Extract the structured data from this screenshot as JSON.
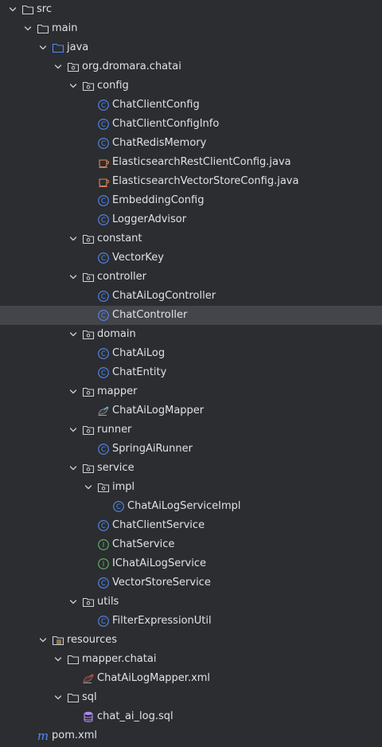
{
  "tree": {
    "items": [
      {
        "label": "src",
        "depth": 0,
        "icon": "folder-icon",
        "expanded": true
      },
      {
        "label": "main",
        "depth": 1,
        "icon": "folder-icon",
        "expanded": true
      },
      {
        "label": "java",
        "depth": 2,
        "icon": "source-root-folder-icon",
        "expanded": true
      },
      {
        "label": "org.dromara.chatai",
        "depth": 3,
        "icon": "package-icon",
        "expanded": true
      },
      {
        "label": "config",
        "depth": 4,
        "icon": "package-icon",
        "expanded": true
      },
      {
        "label": "ChatClientConfig",
        "depth": 5,
        "icon": "class-icon"
      },
      {
        "label": "ChatClientConfigInfo",
        "depth": 5,
        "icon": "class-icon"
      },
      {
        "label": "ChatRedisMemory",
        "depth": 5,
        "icon": "class-icon"
      },
      {
        "label": "ElasticsearchRestClientConfig.java",
        "depth": 5,
        "icon": "java-file-icon"
      },
      {
        "label": "ElasticsearchVectorStoreConfig.java",
        "depth": 5,
        "icon": "java-file-icon"
      },
      {
        "label": "EmbeddingConfig",
        "depth": 5,
        "icon": "class-icon"
      },
      {
        "label": "LoggerAdvisor",
        "depth": 5,
        "icon": "class-icon"
      },
      {
        "label": "constant",
        "depth": 4,
        "icon": "package-icon",
        "expanded": true
      },
      {
        "label": "VectorKey",
        "depth": 5,
        "icon": "class-icon"
      },
      {
        "label": "controller",
        "depth": 4,
        "icon": "package-icon",
        "expanded": true
      },
      {
        "label": "ChatAiLogController",
        "depth": 5,
        "icon": "class-icon"
      },
      {
        "label": "ChatController",
        "depth": 5,
        "icon": "class-icon",
        "selected": true
      },
      {
        "label": "domain",
        "depth": 4,
        "icon": "package-icon",
        "expanded": true
      },
      {
        "label": "ChatAiLog",
        "depth": 5,
        "icon": "class-icon"
      },
      {
        "label": "ChatEntity",
        "depth": 5,
        "icon": "class-icon"
      },
      {
        "label": "mapper",
        "depth": 4,
        "icon": "package-icon",
        "expanded": true
      },
      {
        "label": "ChatAiLogMapper",
        "depth": 5,
        "icon": "mybatis-mapper-icon"
      },
      {
        "label": "runner",
        "depth": 4,
        "icon": "package-icon",
        "expanded": true
      },
      {
        "label": "SpringAiRunner",
        "depth": 5,
        "icon": "class-icon"
      },
      {
        "label": "service",
        "depth": 4,
        "icon": "package-icon",
        "expanded": true
      },
      {
        "label": "impl",
        "depth": 5,
        "icon": "package-icon",
        "expanded": true
      },
      {
        "label": "ChatAiLogServiceImpl",
        "depth": 6,
        "icon": "class-icon"
      },
      {
        "label": "ChatClientService",
        "depth": 5,
        "icon": "class-icon"
      },
      {
        "label": "ChatService",
        "depth": 5,
        "icon": "interface-icon"
      },
      {
        "label": "IChatAiLogService",
        "depth": 5,
        "icon": "interface-icon"
      },
      {
        "label": "VectorStoreService",
        "depth": 5,
        "icon": "class-icon"
      },
      {
        "label": "utils",
        "depth": 4,
        "icon": "package-icon",
        "expanded": true
      },
      {
        "label": "FilterExpressionUtil",
        "depth": 5,
        "icon": "class-icon"
      },
      {
        "label": "resources",
        "depth": 2,
        "icon": "resources-root-folder-icon",
        "expanded": true
      },
      {
        "label": "mapper.chatai",
        "depth": 3,
        "icon": "folder-icon",
        "expanded": true
      },
      {
        "label": "ChatAiLogMapper.xml",
        "depth": 4,
        "icon": "mybatis-xml-icon"
      },
      {
        "label": "sql",
        "depth": 3,
        "icon": "folder-icon",
        "expanded": true
      },
      {
        "label": "chat_ai_log.sql",
        "depth": 4,
        "icon": "sql-file-icon"
      },
      {
        "label": "pom.xml",
        "depth": 1,
        "icon": "maven-icon"
      }
    ]
  },
  "colors": {
    "background": "#2b2d30",
    "selected_row": "#43454a",
    "text": "#dfe1e5",
    "class_icon": "#548af7",
    "interface_icon": "#5fb865",
    "java_file_icon": "#e08855",
    "folder_icon": "#ced0d6",
    "source_folder_icon": "#548af7",
    "sql_icon": "#b189f5",
    "maven_icon": "#548af7"
  }
}
